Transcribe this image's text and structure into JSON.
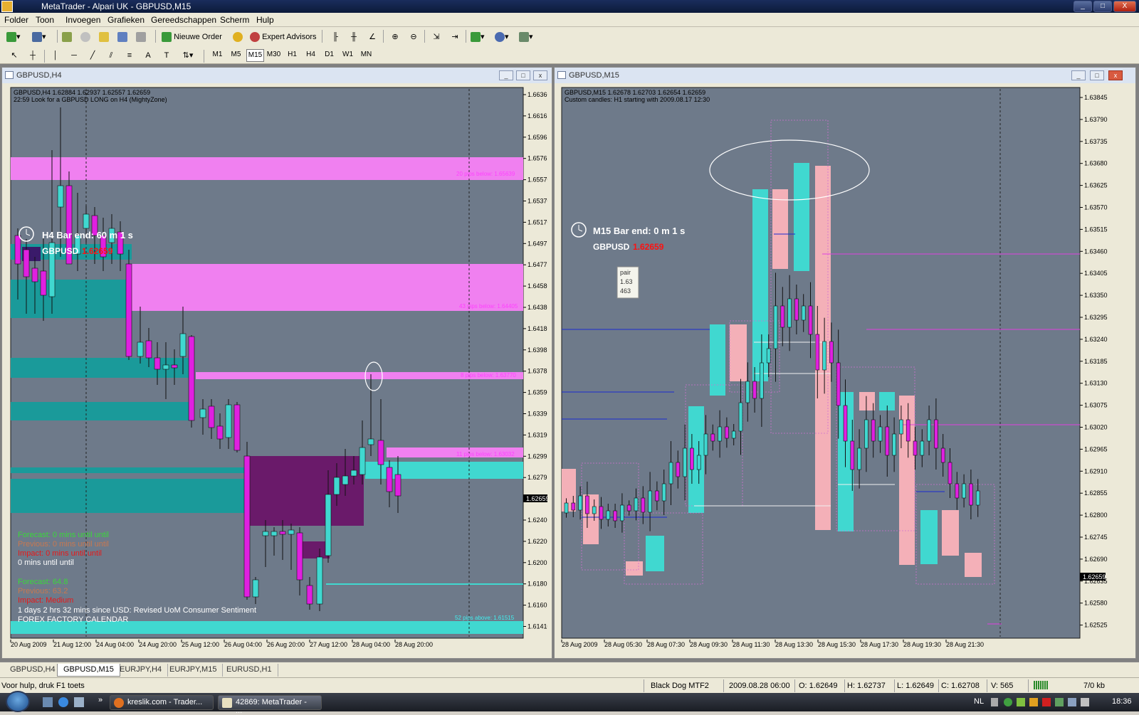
{
  "window": {
    "title": "MetaTrader - Alpari UK - GBPUSD,M15",
    "controls": [
      "_",
      "□",
      "X"
    ]
  },
  "menu": [
    "Folder",
    "Toon",
    "Invoegen",
    "Grafieken",
    "Gereedschappen",
    "Scherm",
    "Hulp"
  ],
  "toolbar": {
    "new_order": "Nieuwe Order",
    "expert_advisors": "Expert Advisors"
  },
  "timeframes": [
    "M1",
    "M5",
    "M15",
    "M30",
    "H1",
    "H4",
    "D1",
    "W1",
    "MN"
  ],
  "active_timeframe": "M15",
  "charts": [
    {
      "title": "GBPUSD,H4",
      "ohlc": "GBPUSD,H4  1.62884 1.62937 1.62557 1.62659",
      "comment": "22:59 Look for a GBPUSD LONG on H4 (MightyZone)",
      "bar_end": "H4 Bar end: 60 m 1 s",
      "pair_label": "GBPUSD",
      "pair_price": "1.62659",
      "price_axis": [
        "1.66360",
        "1.66165",
        "1.65965",
        "1.65765",
        "1.65570",
        "1.65370",
        "1.65170",
        "1.64975",
        "1.64775",
        "1.64580",
        "1.64380",
        "1.64180",
        "1.63985",
        "1.63785",
        "1.63590",
        "1.63390",
        "1.63190",
        "1.62995",
        "1.62795",
        "1.62595",
        "1.62400",
        "1.62200",
        "1.62005",
        "1.61805",
        "1.61605",
        "1.61410"
      ],
      "current_price": "1.62659",
      "time_axis": [
        "20 Aug 2009",
        "21 Aug 12:00",
        "24 Aug 04:00",
        "24 Aug 20:00",
        "25 Aug 12:00",
        "26 Aug 04:00",
        "26 Aug 20:00",
        "27 Aug 12:00",
        "28 Aug 04:00",
        "28 Aug 20:00"
      ],
      "zone_labels": [
        "20 pips below: 1.65639",
        "43 pips below: 1.64405",
        "8 pips below: 1.63770",
        "11 pips below: 1.63032",
        "52 pips above: 1.61515"
      ],
      "calendar": [
        {
          "text": "Forecast: 0 mins until until",
          "color": "#3ad83a"
        },
        {
          "text": "Previous: 0 mins until until",
          "color": "#c87850"
        },
        {
          "text": "Impact: 0 mins until until",
          "color": "#e81818"
        },
        {
          "text": "0 mins until until",
          "color": "#ffffff"
        },
        {
          "text": "Forecast: 64.8",
          "color": "#3ad83a"
        },
        {
          "text": "Previous: 63.2",
          "color": "#c87850"
        },
        {
          "text": "Impact: Medium",
          "color": "#e81818"
        },
        {
          "text": "1 days 2 hrs 32 mins since USD: Revised UoM Consumer Sentiment",
          "color": "#ffffff"
        },
        {
          "text": "FOREX FACTORY CALENDAR",
          "color": "#ffffff"
        }
      ]
    },
    {
      "title": "GBPUSD,M15",
      "ohlc": "GBPUSD,M15  1.62678 1.62703 1.62654 1.62659",
      "comment": "Custom candles: H1 starting with 2009.08.17 12:30",
      "bar_end": "M15 Bar end: 0 m 1 s",
      "pair_label": "GBPUSD",
      "pair_price": "1.62659",
      "tooltip": [
        "pair",
        "1.63",
        "463"
      ],
      "price_axis": [
        "1.63845",
        "1.63790",
        "1.63735",
        "1.63680",
        "1.63625",
        "1.63570",
        "1.63515",
        "1.63460",
        "1.63405",
        "1.63350",
        "1.63295",
        "1.63240",
        "1.63185",
        "1.63130",
        "1.63075",
        "1.63020",
        "1.62965",
        "1.62910",
        "1.62855",
        "1.62800",
        "1.62745",
        "1.62690",
        "1.62635",
        "1.62580",
        "1.62525"
      ],
      "current_price": "1.62659",
      "time_axis": [
        "28 Aug 2009",
        "28 Aug 05:30",
        "28 Aug 07:30",
        "28 Aug 09:30",
        "28 Aug 11:30",
        "28 Aug 13:30",
        "28 Aug 15:30",
        "28 Aug 17:30",
        "28 Aug 19:30",
        "28 Aug 21:30"
      ]
    }
  ],
  "tabs": [
    "GBPUSD,H4",
    "GBPUSD,M15",
    "EURJPY,H4",
    "EURJPY,M15",
    "EURUSD,H1"
  ],
  "active_tab": "GBPUSD,M15",
  "status": {
    "help": "Voor hulp, druk F1 toets",
    "profile": "Black Dog MTF2",
    "datetime": "2009.08.28 06:00",
    "open": "O: 1.62649",
    "high": "H: 1.62737",
    "low": "L: 1.62649",
    "close": "C: 1.62708",
    "volume": "V: 565",
    "traffic": "7/0 kb"
  },
  "taskbar": {
    "items": [
      "kreslik.com - Trader...",
      "42869: MetaTrader - ..."
    ],
    "lang": "NL",
    "clock": "18:36"
  },
  "colors": {
    "plot_bg": "#6e7a8a",
    "bull": "#40d8d0",
    "bear": "#e020e0",
    "zone_pink": "#f080f0",
    "zone_teal": "#00a0a0",
    "zone_purple": "#6a1a6a"
  }
}
